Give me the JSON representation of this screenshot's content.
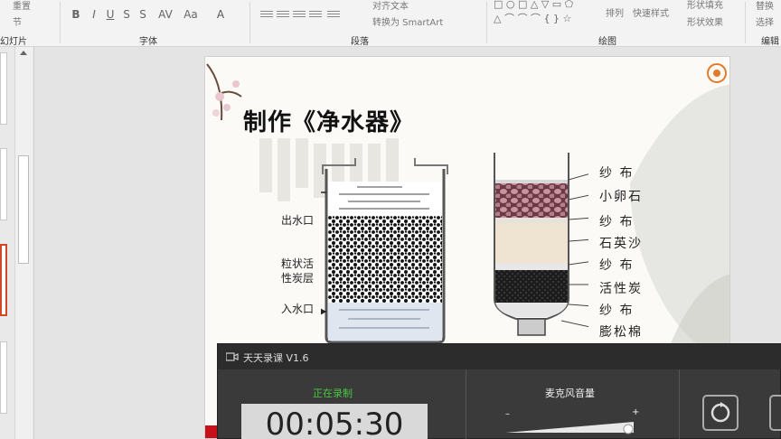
{
  "ribbon": {
    "clip_items": [
      "重置",
      "节"
    ],
    "slides_label": "幻灯片",
    "font_label": "字体",
    "font_buttons": [
      "B",
      "I",
      "U",
      "S",
      "AV",
      "Aa",
      "A"
    ],
    "paragraph_label": "段落",
    "align_text_label": "对齐文本",
    "smartart_label": "转换为 SmartArt",
    "drawing_label": "绘图",
    "arrange_label": "排列",
    "quick_styles_label": "快速样式",
    "shape_fill_label": "形状填充",
    "shape_effects_label": "形状效果",
    "editing_label": "编辑",
    "select_label": "选择",
    "edit_extra": "替换"
  },
  "slide": {
    "title": "制作《净水器》",
    "left_labels": [
      "出水口",
      "粒状活",
      "性炭层",
      "入水口"
    ],
    "right_labels": [
      "纱  布",
      "小卵石",
      "纱  布",
      "石英沙",
      "纱  布",
      "活性炭",
      "纱  布",
      "膨松棉"
    ]
  },
  "recorder": {
    "app_title": "天天录课 V1.6",
    "status": "正在录制",
    "time": "00:05:30",
    "mic_label": "麦克风音量",
    "minus": "–",
    "plus": "+"
  },
  "colors": {
    "recording_green": "#49c843",
    "slide_red": "#c8101a"
  }
}
